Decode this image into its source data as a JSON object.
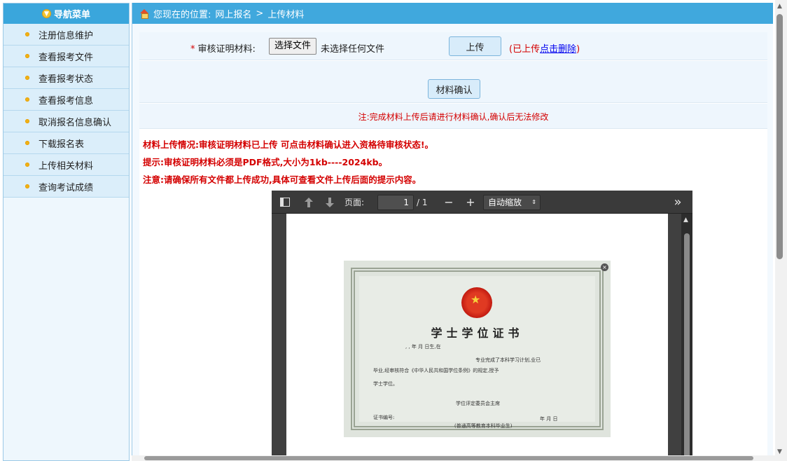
{
  "sidebar": {
    "title": "导航菜单",
    "items": [
      {
        "label": "注册信息维护"
      },
      {
        "label": "查看报考文件"
      },
      {
        "label": "查看报考状态"
      },
      {
        "label": "查看报考信息"
      },
      {
        "label": "取消报名信息确认"
      },
      {
        "label": "下载报名表"
      },
      {
        "label": "上传相关材料"
      },
      {
        "label": "查询考试成绩"
      }
    ]
  },
  "breadcrumb": {
    "prefix": "您现在的位置:",
    "section": "网上报名",
    "separator": ">",
    "current": "上传材料"
  },
  "upload_form": {
    "required_mark": "*",
    "field_label": "审核证明材料:",
    "file_button": "选择文件",
    "file_status": "未选择任何文件",
    "upload_button": "上传",
    "uploaded_prefix": "(已上传",
    "delete_link": "点击删除",
    "uploaded_suffix": ")",
    "confirm_button": "材料确认",
    "confirm_note": "注:完成材料上传后请进行材料确认,确认后无法修改"
  },
  "messages": {
    "status": "材料上传情况:审核证明材料已上传 可点击材料确认进入资格待审核状态!。",
    "hint": "提示:审核证明材料必须是PDF格式,大小为1kb----2024kb。",
    "notice": "注意:请确保所有文件都上传成功,具体可查看文件上传后面的提示内容。"
  },
  "pdf_viewer": {
    "page_label": "页面:",
    "page_number": "1",
    "page_total": "/ 1",
    "zoom_value": "自动缩放",
    "zoom_out": "−",
    "zoom_in": "+",
    "more": "»",
    "certificate": {
      "title": "学士学位证书",
      "line1": ",  ,    年    月    日生,在",
      "line2": "专业完成了本科学习计划,业已",
      "line3": "毕业,经审核符合《中华人民共和国学位条例》的规定,授予",
      "line4": "学士学位。",
      "committee": "学位评定委员会主席",
      "cert_no": "证书编号:",
      "date": "年      月      日",
      "footer": "(普通高等教育本科毕业生)"
    }
  }
}
